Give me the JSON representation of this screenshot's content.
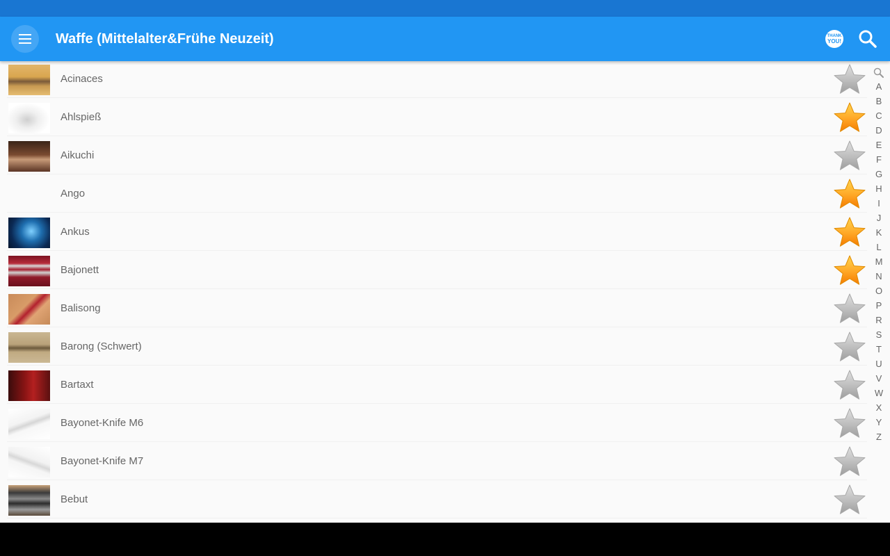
{
  "app_bar": {
    "title": "Waffe (Mittelalter&Frühe Neuzeit)",
    "menu_icon": "hamburger-menu-icon",
    "thanks_top": "THANK",
    "thanks_bottom": "YOU!",
    "search_icon": "search-icon"
  },
  "colors": {
    "status_bar": "#1976d2",
    "app_bar": "#2196f3",
    "star_active": "#ffa000",
    "star_inactive": "#b0b0b0"
  },
  "items": [
    {
      "label": "Acinaces",
      "favorite": false
    },
    {
      "label": "Ahlspieß",
      "favorite": true
    },
    {
      "label": "Aikuchi",
      "favorite": false
    },
    {
      "label": "Ango",
      "favorite": true
    },
    {
      "label": "Ankus",
      "favorite": true
    },
    {
      "label": "Bajonett",
      "favorite": true
    },
    {
      "label": "Balisong",
      "favorite": false
    },
    {
      "label": "Barong (Schwert)",
      "favorite": false
    },
    {
      "label": "Bartaxt",
      "favorite": false
    },
    {
      "label": "Bayonet-Knife M6",
      "favorite": false
    },
    {
      "label": "Bayonet-Knife M7",
      "favorite": false
    },
    {
      "label": "Bebut",
      "favorite": false
    },
    {
      "label": "",
      "favorite": false
    }
  ],
  "index": {
    "search_icon": "magnifier-icon",
    "letters": [
      "A",
      "B",
      "C",
      "D",
      "E",
      "F",
      "G",
      "H",
      "I",
      "J",
      "K",
      "L",
      "M",
      "N",
      "O",
      "P",
      "R",
      "S",
      "T",
      "U",
      "V",
      "W",
      "X",
      "Y",
      "Z"
    ]
  }
}
